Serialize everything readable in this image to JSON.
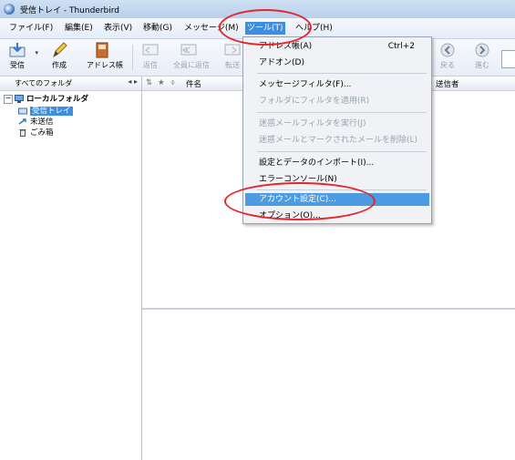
{
  "window": {
    "title": "受信トレイ - Thunderbird"
  },
  "menubar": {
    "items": [
      {
        "label": "ファイル(F)"
      },
      {
        "label": "編集(E)"
      },
      {
        "label": "表示(V)"
      },
      {
        "label": "移動(G)"
      },
      {
        "label": "メッセージ(M)"
      },
      {
        "label": "ツール(T)"
      },
      {
        "label": "ヘルプ(H)"
      }
    ],
    "active": "ツール(T)"
  },
  "toolbar": {
    "get_label": "受信",
    "compose_label": "作成",
    "address_label": "アドレス帳",
    "reply_label": "返信",
    "reply_all_label": "全員に返信",
    "forward_label": "転送",
    "back_label": "戻る",
    "next_label": "進む"
  },
  "folder_pane": {
    "header": "すべてのフォルダ",
    "nav_arrows": "◂ ▸",
    "root": "ローカルフォルダ",
    "folders": [
      {
        "label": "受信トレイ",
        "selected": true
      },
      {
        "label": "未送信",
        "selected": false
      },
      {
        "label": "ごみ箱",
        "selected": false
      }
    ]
  },
  "thread_pane": {
    "columns": {
      "subject": "件名",
      "sender": "送信者"
    }
  },
  "tools_menu": {
    "items": [
      {
        "label": "アドレス帳(A)",
        "shortcut": "Ctrl+2",
        "disabled": false
      },
      {
        "label": "アドオン(D)",
        "disabled": false
      },
      {
        "label": "メッセージフィルタ(F)...",
        "disabled": false
      },
      {
        "label": "フォルダにフィルタを適用(R)",
        "disabled": true
      },
      {
        "label": "迷惑メールフィルタを実行(J)",
        "disabled": true
      },
      {
        "label": "迷惑メールとマークされたメールを削除(L)",
        "disabled": true
      },
      {
        "label": "設定とデータのインポート(I)...",
        "disabled": false
      },
      {
        "label": "エラーコンソール(N)",
        "disabled": false
      },
      {
        "label": "アカウント設定(C)...",
        "disabled": false,
        "highlighted": true
      },
      {
        "label": "オプション(O)...",
        "disabled": false
      }
    ]
  },
  "colors": {
    "accent": "#3d8ee0",
    "annotation": "#e3262c"
  }
}
